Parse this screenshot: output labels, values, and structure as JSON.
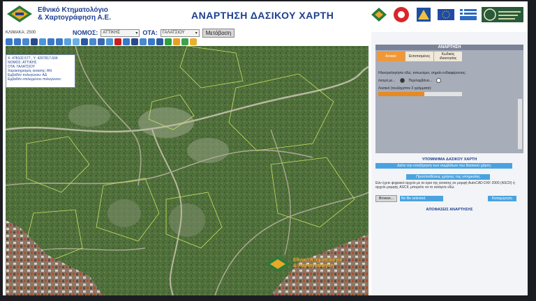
{
  "header": {
    "logo_line1": "Εθνικό Κτηματολόγιο",
    "logo_line2": "& Χαρτογράφηση Α.Ε.",
    "title": "ΑΝΑΡΤΗΣΗ ΔΑΣΙΚΟΥ ΧΑΡΤΗ"
  },
  "toolbar": {
    "scale_label": "ΚΛΙΜΑΚΑ: 2500",
    "nomos_label": "ΝΟΜΟΣ:",
    "nomos_value": "ΑΤΤΙΚΗΣ",
    "ota_label": "ΟΤΑ:",
    "ota_value": "ΓΑΛΑΤΣΙΟΥ",
    "go_label": "Μετάβαση"
  },
  "coord_box": {
    "line1": "Χ: 478102.577 , Υ: 4207817.604",
    "line2": "ΝΟΜΟΣ: ΑΤΤΙΚΗΣ",
    "line3": "ΟΤΑ: ΓΑΛΑΤΣΙΟΥ",
    "line4": "Χαρακτηρισμός έκτασης: ΑΝ",
    "line5": "Εμβαδόν πολυγώνου: ΑΔ",
    "line6": "Εμβαδόν επιλεγμένου πολυγώνου:"
  },
  "watermark": {
    "line1": "Εθνικό Κτηματολόγιο",
    "line2": "& Χαρτογράφηση"
  },
  "panel": {
    "head": "ΑΝΑΡΤΗΣΗ",
    "tabs": [
      "Αιτιακό",
      "Εντοπισμένες",
      "Κωδικός ιδιοκτησίας"
    ],
    "question": "Ηλεκτρολογήστε εδώ, τοπωνύμιο, σημείο ενδιαφέροντος:",
    "radio1": "όνομα με...",
    "radio2": "Περιλαμβάνει...",
    "hint": "Λεκτικό (τουλάχιστον 3 γράμματα):",
    "progress_percent": 55,
    "legend_title": "ΥΠΟΜΝΗΜΑ ΔΑΣΙΚΟΥ ΧΑΡΤΗ",
    "legend_button": "Δείτε την επεξήγηση των συμβόλων του δασικού χάρτη",
    "conditions_button": "Προϋποθέσεις χρήσης της υπηρεσίας",
    "upload_text": "Εάν έχετε ψηφιακό αρχείο με τα όρια της έκτασης σε μορφή AutoCAD DXF 2000 (ASCII) ή αρχείο μορφής ASCII, μπορείτε να το εισάγετε εδώ.",
    "browse_label": "Browse...",
    "file_label": "No file selected.",
    "submit_label": "Καταχώρηση",
    "decision_link": "ΑΠΟΦΑΣΕΙΣ ΑΝΑΡΤΗΣΗΣ"
  }
}
